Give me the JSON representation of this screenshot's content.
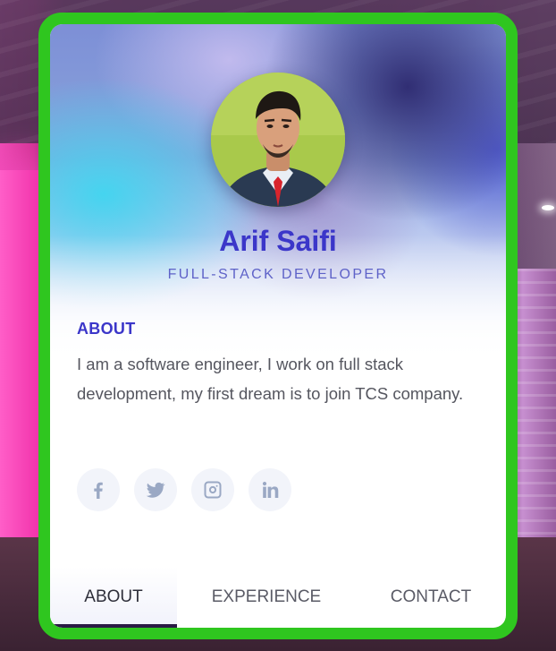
{
  "profile": {
    "name": "Arif Saifi",
    "title": "FULL-STACK DEVELOPER"
  },
  "about": {
    "heading": "ABOUT",
    "text": "I am a software engineer, I work on full stack development, my first dream is to join TCS company."
  },
  "socials": [
    {
      "icon": "facebook-icon"
    },
    {
      "icon": "twitter-icon"
    },
    {
      "icon": "instagram-icon"
    },
    {
      "icon": "linkedin-icon"
    }
  ],
  "tabs": [
    {
      "label": "ABOUT",
      "active": true
    },
    {
      "label": "EXPERIENCE",
      "active": false
    },
    {
      "label": "CONTACT",
      "active": false
    }
  ],
  "colors": {
    "frame": "#2fc61f",
    "accent": "#3b36c9",
    "subtitle": "#5e62c8",
    "body_text": "#55565f",
    "social_bg": "#f2f4fa",
    "social_icon": "#9aa8c4",
    "tab_indicator": "#2a1a44"
  }
}
